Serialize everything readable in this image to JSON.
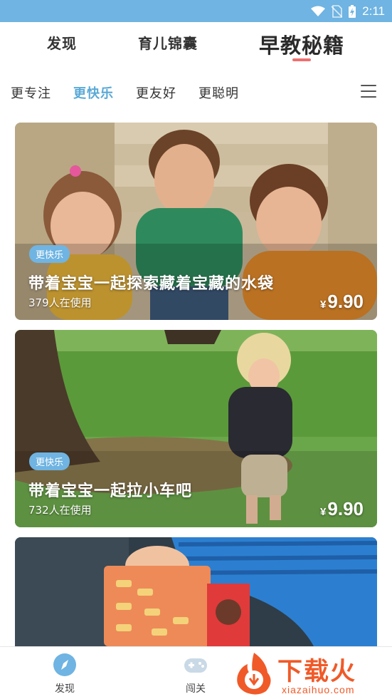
{
  "status_bar": {
    "time": "2:11",
    "background": "#6fb4e2",
    "icons": [
      "wifi-icon",
      "no-sim-icon",
      "battery-charging-icon"
    ]
  },
  "top_tabs": [
    {
      "label": "发现",
      "active": false
    },
    {
      "label": "育儿锦囊",
      "active": false
    },
    {
      "label": "早教秘籍",
      "active": true
    }
  ],
  "sub_tabs": [
    {
      "label": "更专注",
      "active": false
    },
    {
      "label": "更快乐",
      "active": true
    },
    {
      "label": "更友好",
      "active": false
    },
    {
      "label": "更聪明",
      "active": false
    }
  ],
  "cards": [
    {
      "tag": "更快乐",
      "title": "带着宝宝一起探索藏着宝藏的水袋",
      "users": "379人在使用",
      "currency": "¥",
      "price": "9.90"
    },
    {
      "tag": "更快乐",
      "title": "带着宝宝一起拉小车吧",
      "users": "732人在使用",
      "currency": "¥",
      "price": "9.90"
    },
    {
      "tag": "",
      "title": "",
      "users": "",
      "currency": "",
      "price": ""
    }
  ],
  "bottom_nav": [
    {
      "label": "发现",
      "icon": "compass-icon",
      "active": true
    },
    {
      "label": "闯关",
      "icon": "gamepad-icon",
      "active": false
    }
  ],
  "watermark": {
    "text": "下载火",
    "sub": "xiazaihuo.com"
  },
  "colors": {
    "accent": "#6fb4e2",
    "tab_underline": "#ef6f6f",
    "watermark": "#f05a28"
  }
}
